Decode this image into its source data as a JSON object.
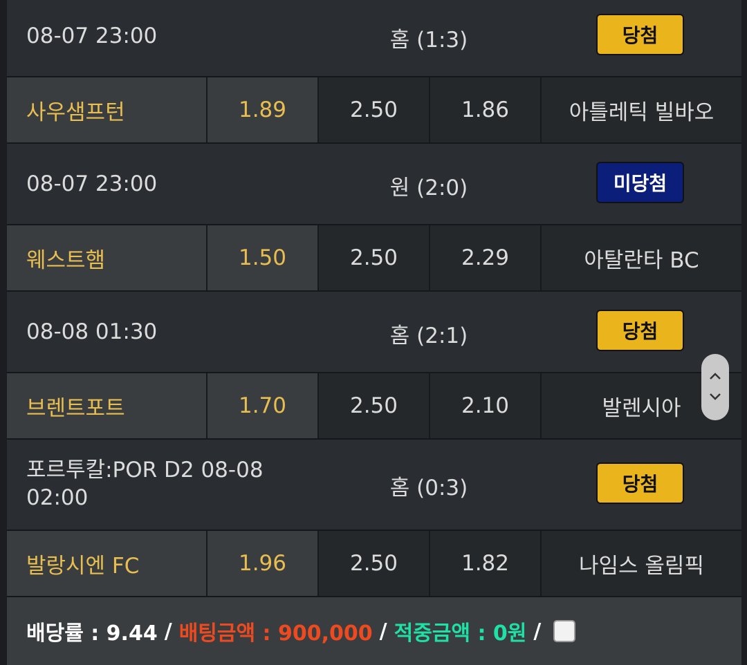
{
  "bets": [
    {
      "date": "08-07 23:00",
      "result": "홈 (1:3)",
      "status": "당첨",
      "status_type": "win",
      "home_team": "사우샘프턴",
      "home_odds": "1.89",
      "draw_odds": "2.50",
      "away_odds": "1.86",
      "away_team": "아틀레틱 빌바오"
    },
    {
      "date": "08-07 23:00",
      "result": "원 (2:0)",
      "status": "미당첨",
      "status_type": "lose",
      "home_team": "웨스트햄",
      "home_odds": "1.50",
      "draw_odds": "2.50",
      "away_odds": "2.29",
      "away_team": "아탈란타 BC"
    },
    {
      "date": "08-08 01:30",
      "result": "홈 (2:1)",
      "status": "당첨",
      "status_type": "win",
      "home_team": "브렌트포트",
      "home_odds": "1.70",
      "draw_odds": "2.50",
      "away_odds": "2.10",
      "away_team": "발렌시아"
    },
    {
      "date_line1": "포르투칼:POR D2 08-08",
      "date_line2": "02:00",
      "result": "홈 (0:3)",
      "status": "당첨",
      "status_type": "win",
      "home_team": "발랑시엔 FC",
      "home_odds": "1.96",
      "draw_odds": "2.50",
      "away_odds": "1.82",
      "away_team": "나임스 올림픽"
    }
  ],
  "footer": {
    "odds_label": "배당률 : 9.44",
    "bet_amount_label": "배팅금액 : 900,000",
    "win_amount_label": "적중금액 : 0원",
    "separator": "/"
  },
  "colors": {
    "win_badge": "#eab41c",
    "lose_badge": "#0b1f7a",
    "home_text": "#e9be51",
    "bet_amount": "#ee4a1f",
    "win_amount": "#1fe0a6"
  },
  "scroller": {
    "up_icon": "chevron-up-icon",
    "down_icon": "chevron-down-icon"
  }
}
